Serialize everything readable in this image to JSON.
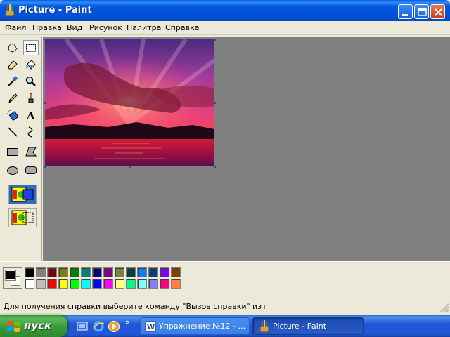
{
  "window": {
    "title": "Picture - Paint"
  },
  "menu": [
    "Файл",
    "Правка",
    "Вид",
    "Рисунок",
    "Палитра",
    "Справка"
  ],
  "tools": [
    "free-form-select",
    "rectangle-select",
    "eraser",
    "fill-with-color",
    "pick-color",
    "magnifier",
    "pencil",
    "brush",
    "airbrush",
    "text",
    "line",
    "curve",
    "rectangle",
    "polygon",
    "ellipse",
    "rounded-rectangle"
  ],
  "active_tool": "rectangle-select",
  "palette": {
    "foreground": "#000000",
    "background": "#ffffff",
    "row1": [
      "#000000",
      "#808080",
      "#800000",
      "#808000",
      "#008000",
      "#008080",
      "#000080",
      "#800080",
      "#808040",
      "#004040",
      "#0080ff",
      "#004080",
      "#8000ff",
      "#804000"
    ],
    "row2": [
      "#ffffff",
      "#c0c0c0",
      "#ff0000",
      "#ffff00",
      "#00ff00",
      "#00ffff",
      "#0000ff",
      "#ff00ff",
      "#ffff80",
      "#00ff80",
      "#80ffff",
      "#8080ff",
      "#ff0080",
      "#ff8040"
    ]
  },
  "status": {
    "text": "Для получения справки выберите команду \"Вызов справки\" из меню \"Справка\"."
  },
  "taskbar": {
    "start_label": "пуск",
    "chevron": "»",
    "tasks": [
      {
        "label": "Упражнение №12 - ...",
        "active": false
      },
      {
        "label": "Picture - Paint",
        "active": true
      }
    ]
  }
}
